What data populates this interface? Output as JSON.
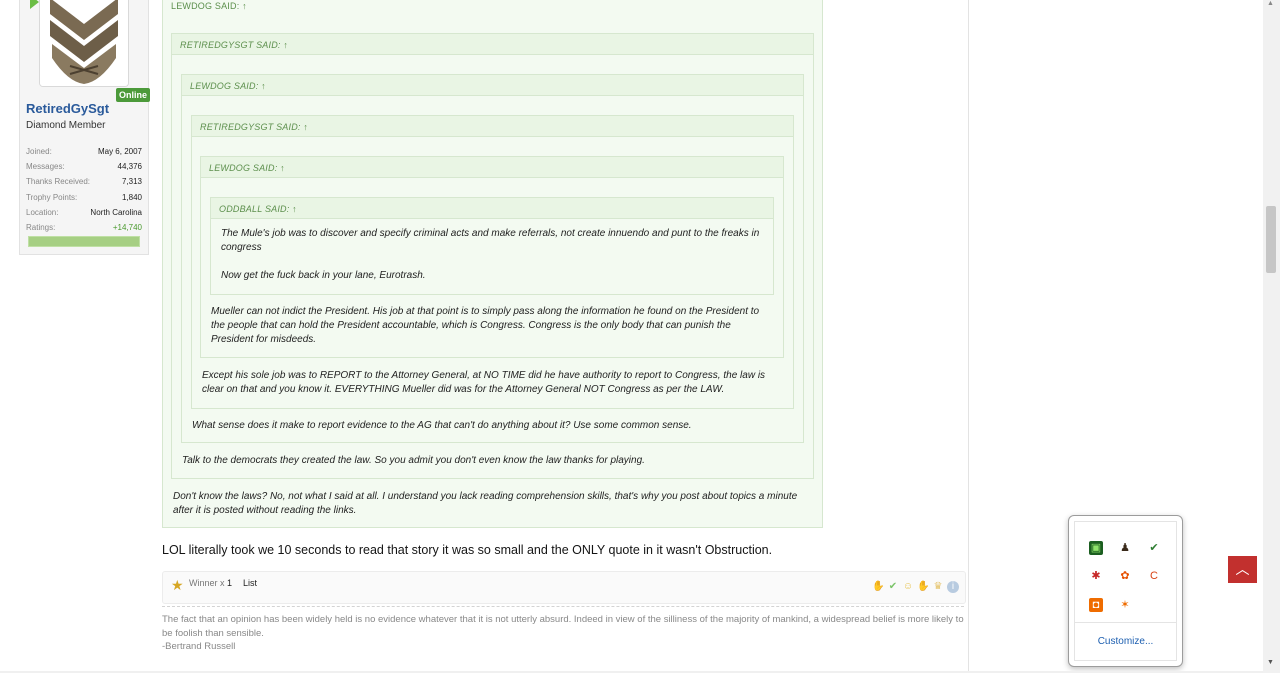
{
  "user": {
    "online_label": "Online",
    "username": "RetiredGySgt",
    "title": "Diamond Member",
    "stats": [
      {
        "key": "Joined:",
        "value": "May 6, 2007"
      },
      {
        "key": "Messages:",
        "value": "44,376"
      },
      {
        "key": "Thanks Received:",
        "value": "7,313"
      },
      {
        "key": "Trophy Points:",
        "value": "1,840"
      },
      {
        "key": "Location:",
        "value": "North Carolina"
      },
      {
        "key": "Ratings:",
        "value": "+14,740"
      }
    ],
    "rating_fraction": 1.0
  },
  "quotes": {
    "q1_head": "LEWDOG SAID: ↑",
    "q2_head": "RETIREDGYSGT SAID: ↑",
    "q3_head": "LEWDOG SAID: ↑",
    "q4_head": "RETIREDGYSGT SAID: ↑",
    "q5_head": "LEWDOG SAID: ↑",
    "q6_head": "ODDBALL SAID: ↑",
    "q6_text1": "The Mule's job was to discover and specify criminal acts and make referrals, not create innuendo and punt to the freaks in congress",
    "q6_text2": "Now get the fuck back in your lane, Eurotrash.",
    "q5_text": "Mueller can not indict the President. His job at that point is to simply pass along the information he found on the President to the people that can hold the President accountable, which is Congress. Congress is the only body that can punish the President for misdeeds.",
    "q4_text": "Except his sole job was to REPORT to the Attorney General, at NO TIME did he have authority to report to Congress, the law is clear on that and you know it. EVERYTHING Mueller did was for the Attorney General NOT Congress as per the LAW.",
    "q3_text": "What sense does it make to report evidence to the AG that can't do anything about it? Use some common sense.",
    "q2_text": "Talk to the democrats they created the law. So you admit you don't even know the law thanks for playing.",
    "q1_text": "Don't know the laws? No, not what I said at all. I understand you lack reading comprehension skills, that's why you post about topics a minute after it is posted without reading the links."
  },
  "post": {
    "body": "LOL literally took we 10 seconds to read that story it was so small and the ONLY quote in it wasn't Obstruction."
  },
  "reactions": {
    "winner_label": "Winner",
    "winner_x": "x",
    "winner_count": "1",
    "list_label": "List"
  },
  "signature": {
    "line1": "The fact that an opinion has been widely held is no evidence whatever that it is not utterly absurd. Indeed in view of the silliness of the majority of mankind, a widespread belief is more likely to be foolish than sensible.",
    "line2": "-Bertrand Russell"
  },
  "tray": {
    "customize_label": "Customize..."
  },
  "colors": {
    "quote_bg": "#f3faf1",
    "quote_border": "#d6e7cf",
    "username": "#2a5a9b",
    "scroll_top_button": "#c2302e"
  }
}
